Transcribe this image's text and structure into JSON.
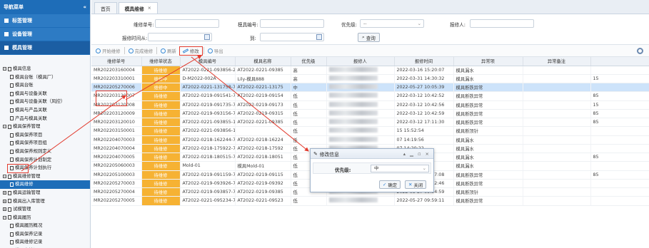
{
  "sidebar": {
    "header": "导航菜单",
    "collapse_glyph": "«",
    "sections": [
      "标签管理",
      "设备管理",
      "模具管理"
    ],
    "tree": [
      {
        "level": 1,
        "toggle": "−",
        "label": "模具信息"
      },
      {
        "level": 2,
        "label": "模具台账（模具厂）"
      },
      {
        "level": 2,
        "label": "模具台账"
      },
      {
        "level": 2,
        "label": "模具与设备关联"
      },
      {
        "level": 2,
        "label": "模具与设备关联（风控）"
      },
      {
        "level": 2,
        "label": "模具与产品关联"
      },
      {
        "level": 2,
        "label": "产品与模具关联"
      },
      {
        "level": 1,
        "toggle": "−",
        "label": "模具保养管理"
      },
      {
        "level": 2,
        "label": "模具保养项目"
      },
      {
        "level": 2,
        "label": "模具保养项目组"
      },
      {
        "level": 2,
        "label": "模具保养规则定义"
      },
      {
        "level": 2,
        "label": "模具保养计划制定"
      },
      {
        "level": 2,
        "label": "模具保养计划执行"
      },
      {
        "level": 1,
        "toggle": "−",
        "label": "模具维修管理"
      },
      {
        "level": 2,
        "label": "模具维修",
        "selected": true
      },
      {
        "level": 1,
        "toggle": "+",
        "label": "模具运输管理"
      },
      {
        "level": 1,
        "toggle": "+",
        "label": "模具出入库管理"
      },
      {
        "level": 1,
        "toggle": "+",
        "label": "试模管理"
      },
      {
        "level": 1,
        "toggle": "−",
        "label": "模具履历"
      },
      {
        "level": 2,
        "label": "模具履历概况"
      },
      {
        "level": 2,
        "label": "模具保养记录"
      },
      {
        "level": 2,
        "label": "模具维修记录"
      },
      {
        "level": 2,
        "label": "模具点检记录"
      }
    ]
  },
  "tabs": {
    "home": "首页",
    "active": "模具维修",
    "close": "×"
  },
  "filters": {
    "repair_no_label": "维修单号:",
    "mold_no_label": "模具编号:",
    "priority_label": "优先级:",
    "priority_value": "--",
    "reporter_label": "报修人:",
    "time_from_label": "报修时间从:",
    "time_to_label": "到:",
    "query_label": "查询"
  },
  "toolbar": {
    "start": "开始维修",
    "complete": "完成维修",
    "refresh": "刷新",
    "edit": "修改",
    "export": "导出"
  },
  "columns": [
    "维修单号",
    "维修单状态",
    "模具编号",
    "模具名称",
    "优先级",
    "报修人",
    "报修时间",
    "异常项",
    "异常备注",
    ""
  ],
  "rows": [
    [
      "MR202203160004",
      "待维修",
      "AT2022-0221-093856-2",
      "AT2022-0221-09385",
      "高",
      "",
      "2022-03-16 15:20:07",
      "模具漏水",
      "",
      ""
    ],
    [
      "MR202203310001",
      "维修中",
      "D-M2022-002A",
      "Lily-模具888",
      "高",
      "",
      "2022-03-31 14:30:32",
      "模具漏水",
      "",
      "15"
    ],
    [
      "MR202205270006",
      "维修中",
      "AT2022-0221-131758-7",
      "AT2022-0221-13175",
      "中",
      "",
      "2022-05-27 10:05:39",
      "模具断铁异常",
      "",
      ""
    ],
    [
      "MR202203120007",
      "待维修",
      "AT2022-0219-091541-7",
      "AT2022-0219-09154",
      "低",
      "",
      "2022-03-12 10:42:52",
      "模具断铁异常",
      "",
      "85"
    ],
    [
      "MR202203120008",
      "待维修",
      "AT2022-0219-091735-7",
      "AT2022-0219-09173",
      "低",
      "",
      "2022-03-12 10:42:56",
      "模具断铁异常",
      "",
      "15"
    ],
    [
      "MR202203120009",
      "待维修",
      "AT2022-0219-093156-7",
      "AT2022-0219-09315",
      "低",
      "",
      "2022-03-12 10:42:59",
      "模具断铁异常",
      "",
      "85"
    ],
    [
      "MR202203120010",
      "待维修",
      "AT2022-0221-093855-1",
      "AT2022-0221-09385",
      "低",
      "",
      "2022-03-12 17:11:30",
      "模具断铁异常",
      "",
      "85"
    ],
    [
      "MR202203150001",
      "待维修",
      "AT2022-0221-093856-1",
      "",
      "低",
      "",
      "15 15:52:54",
      "模具断顶针",
      "",
      ""
    ],
    [
      "MR202204070003",
      "待维修",
      "AT2022-0218-162244-7",
      "AT2022-0218-16224",
      "低",
      "",
      "07 14:19:56",
      "模具漏水",
      "",
      ""
    ],
    [
      "MR202204070004",
      "待维修",
      "AT2022-0218-175922-7",
      "AT2022-0218-17592",
      "低",
      "",
      "07 14:20:22",
      "模具漏水",
      "",
      ""
    ],
    [
      "MR202204070005",
      "待维修",
      "AT2022-0218-180515-7",
      "AT2022-0218-18051",
      "低",
      "",
      "07 14:41:29",
      "模具漏水",
      "",
      "85"
    ],
    [
      "MR202205060003",
      "待维修",
      "Mold-01",
      "模具Mold-01",
      "低",
      "",
      "06 21:03:55",
      "模具漏水",
      "",
      ""
    ],
    [
      "MR202205100003",
      "待维修",
      "AT2022-0219-091159-7",
      "AT2022-0219-09115",
      "低",
      "",
      "2022-05-10 09:57:08",
      "模具断铁异常",
      "",
      "85"
    ],
    [
      "MR202205270003",
      "待维修",
      "AT2022-0219-093926-7",
      "AT2022-0219-09392",
      "低",
      "",
      "2022-05-27 09:52:46",
      "模具断铁异常",
      "",
      ""
    ],
    [
      "MR202205270004",
      "待维修",
      "AT2022-0219-093857-7",
      "AT2022-0219-09385",
      "低",
      "",
      "2022-05-27 09:54:59",
      "模具断顶针",
      "",
      ""
    ],
    [
      "MR202205270005",
      "待维修",
      "AT2022-0221-095234-7",
      "AT2022-0221-09523",
      "低",
      "",
      "2022-05-27 09:59:11",
      "模具断铁异常",
      "",
      ""
    ]
  ],
  "dialog": {
    "title": "修改信息",
    "controls": "▴ ▁ ▫ ×",
    "priority_label": "优先级:",
    "priority_value": "中",
    "confirm": "确定",
    "close": "关闭"
  },
  "colors": {
    "accent": "#1e6db8",
    "status_pending": "#f6b233",
    "selected_row": "#cde3fa",
    "annotation": "#e23b2e"
  }
}
